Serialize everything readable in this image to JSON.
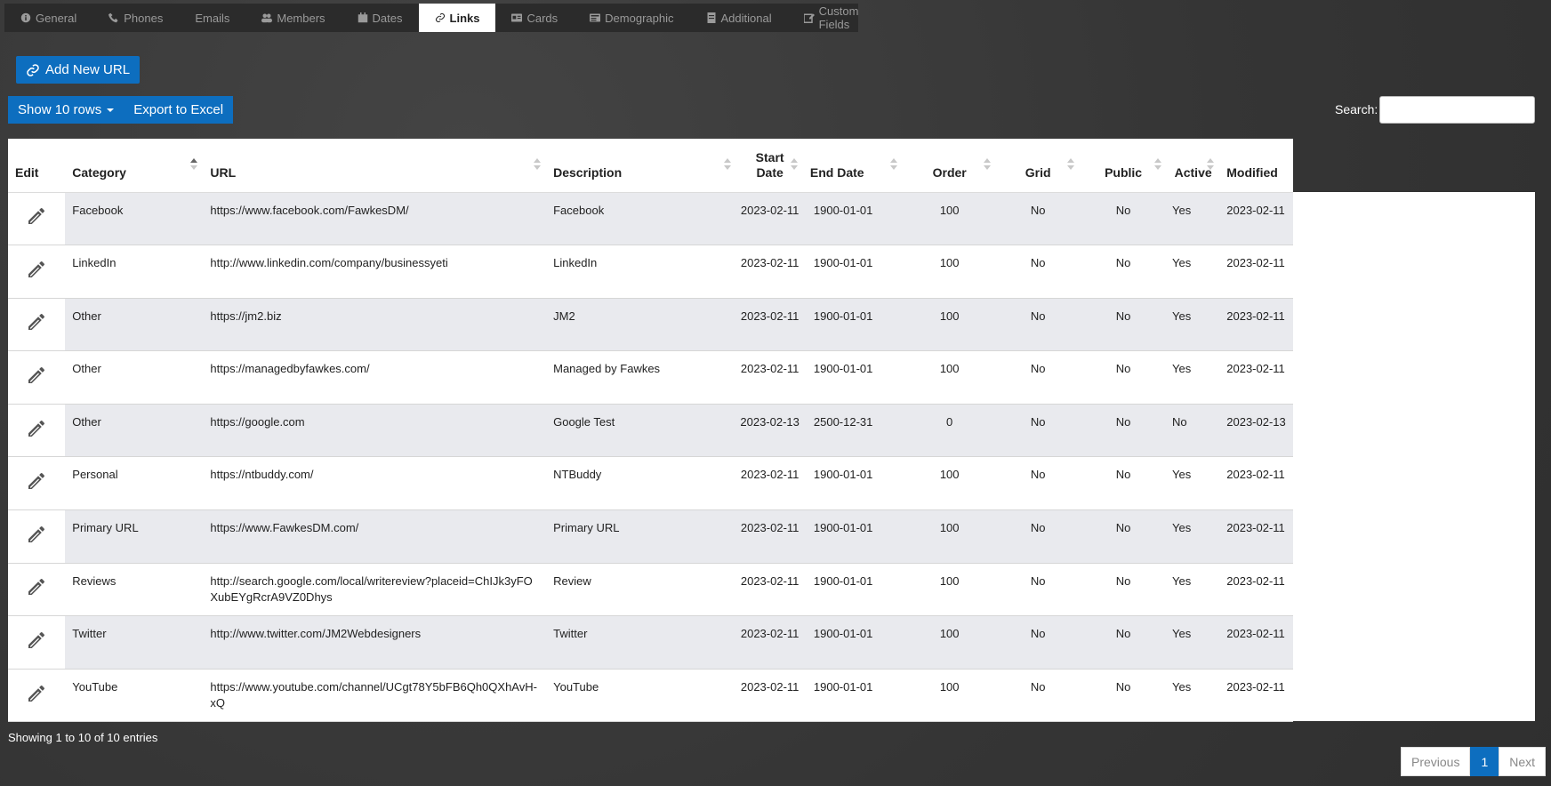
{
  "tabs": [
    {
      "label": "General",
      "icon": "info-icon"
    },
    {
      "label": "Phones",
      "icon": "phone-icon"
    },
    {
      "label": "Emails",
      "icon": ""
    },
    {
      "label": "Members",
      "icon": "users-icon"
    },
    {
      "label": "Dates",
      "icon": "calendar-icon"
    },
    {
      "label": "Links",
      "icon": "link-icon",
      "active": true
    },
    {
      "label": "Cards",
      "icon": "card-icon"
    },
    {
      "label": "Demographic",
      "icon": "id-card-icon"
    },
    {
      "label": "Additional",
      "icon": "document-icon"
    },
    {
      "label": "Custom Fields",
      "icon": "edit-icon"
    }
  ],
  "add_url_label": "Add New URL",
  "toolbar": {
    "show_rows_label": "Show 10 rows",
    "export_label": "Export to Excel"
  },
  "search": {
    "label": "Search:",
    "value": ""
  },
  "table": {
    "headers": [
      "Edit",
      "Category",
      "URL",
      "Description",
      "Start Date",
      "End Date",
      "Order",
      "Grid",
      "Public",
      "Active",
      "Modified"
    ],
    "rows": [
      {
        "category": "Facebook",
        "url": "https://www.facebook.com/FawkesDM/",
        "description": "Facebook",
        "start": "2023-02-11",
        "end": "1900-01-01",
        "order": "100",
        "grid": "No",
        "public": "No",
        "active": "Yes",
        "modified": "2023-02-11"
      },
      {
        "category": "LinkedIn",
        "url": "http://www.linkedin.com/company/businessyeti",
        "description": "LinkedIn",
        "start": "2023-02-11",
        "end": "1900-01-01",
        "order": "100",
        "grid": "No",
        "public": "No",
        "active": "Yes",
        "modified": "2023-02-11"
      },
      {
        "category": "Other",
        "url": "https://jm2.biz",
        "description": "JM2",
        "start": "2023-02-11",
        "end": "1900-01-01",
        "order": "100",
        "grid": "No",
        "public": "No",
        "active": "Yes",
        "modified": "2023-02-11"
      },
      {
        "category": "Other",
        "url": "https://managedbyfawkes.com/",
        "description": "Managed by Fawkes",
        "start": "2023-02-11",
        "end": "1900-01-01",
        "order": "100",
        "grid": "No",
        "public": "No",
        "active": "Yes",
        "modified": "2023-02-11"
      },
      {
        "category": "Other",
        "url": "https://google.com",
        "description": "Google Test",
        "start": "2023-02-13",
        "end": "2500-12-31",
        "order": "0",
        "grid": "No",
        "public": "No",
        "active": "No",
        "modified": "2023-02-13"
      },
      {
        "category": "Personal",
        "url": "https://ntbuddy.com/",
        "description": "NTBuddy",
        "start": "2023-02-11",
        "end": "1900-01-01",
        "order": "100",
        "grid": "No",
        "public": "No",
        "active": "Yes",
        "modified": "2023-02-11"
      },
      {
        "category": "Primary URL",
        "url": "https://www.FawkesDM.com/",
        "description": "Primary URL",
        "start": "2023-02-11",
        "end": "1900-01-01",
        "order": "100",
        "grid": "No",
        "public": "No",
        "active": "Yes",
        "modified": "2023-02-11"
      },
      {
        "category": "Reviews",
        "url": "http://search.google.com/local/writereview?placeid=ChIJk3yFOXubEYgRcrA9VZ0Dhys",
        "description": "Review",
        "start": "2023-02-11",
        "end": "1900-01-01",
        "order": "100",
        "grid": "No",
        "public": "No",
        "active": "Yes",
        "modified": "2023-02-11"
      },
      {
        "category": "Twitter",
        "url": "http://www.twitter.com/JM2Webdesigners",
        "description": "Twitter",
        "start": "2023-02-11",
        "end": "1900-01-01",
        "order": "100",
        "grid": "No",
        "public": "No",
        "active": "Yes",
        "modified": "2023-02-11"
      },
      {
        "category": "YouTube",
        "url": "https://www.youtube.com/channel/UCgt78Y5bFB6Qh0QXhAvH-xQ",
        "description": "YouTube",
        "start": "2023-02-11",
        "end": "1900-01-01",
        "order": "100",
        "grid": "No",
        "public": "No",
        "active": "Yes",
        "modified": "2023-02-11"
      }
    ]
  },
  "info_text": "Showing 1 to 10 of 10 entries",
  "pagination": {
    "previous": "Previous",
    "current": "1",
    "next": "Next"
  },
  "colors": {
    "accent": "#0d6ebf",
    "background": "#3a3a3a",
    "row_stripe": "#e9eaee"
  }
}
